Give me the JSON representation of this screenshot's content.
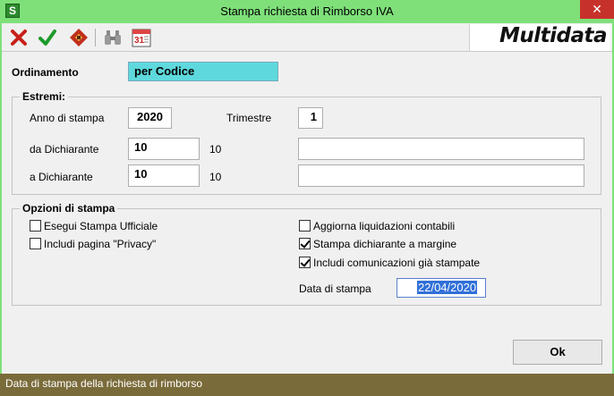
{
  "window": {
    "title": "Stampa richiesta di Rimborso IVA",
    "close": "✕"
  },
  "toolbar": {
    "logo": "Multidata"
  },
  "ordinamento": {
    "label": "Ordinamento",
    "value": "per Codice"
  },
  "estremi": {
    "title": "Estremi:",
    "anno_label": "Anno di stampa",
    "anno_value": "2020",
    "trimestre_label": "Trimestre",
    "trimestre_value": "1",
    "da_label": "da Dichiarante",
    "da_value": "10",
    "da_code": "10",
    "da_desc": "",
    "a_label": "a Dichiarante",
    "a_value": "10",
    "a_code": "10",
    "a_desc": ""
  },
  "opzioni": {
    "title": "Opzioni di stampa",
    "left": [
      {
        "label": "Esegui Stampa Ufficiale",
        "checked": false
      },
      {
        "label": "Includi pagina \"Privacy\"",
        "checked": false
      }
    ],
    "right": [
      {
        "label": "Aggiorna liquidazioni contabili",
        "checked": false
      },
      {
        "label": "Stampa dichiarante a margine",
        "checked": true
      },
      {
        "label": "Includi comunicazioni già stampate",
        "checked": true
      }
    ],
    "data_label": "Data di stampa",
    "data_value": "22/04/2020"
  },
  "ok_label": "Ok",
  "status": "Data di stampa della richiesta di rimborso"
}
